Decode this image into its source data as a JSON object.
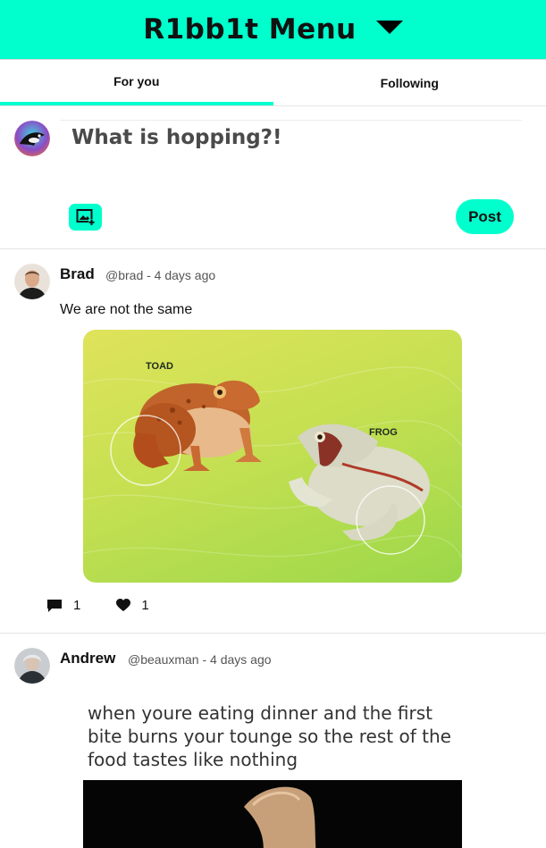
{
  "header": {
    "title": "R1bb1t Menu",
    "menu_icon": "caret-down-icon"
  },
  "tabs": [
    {
      "label": "For you",
      "active": true
    },
    {
      "label": "Following",
      "active": false
    }
  ],
  "composer": {
    "placeholder": "What is hopping?!",
    "media_icon": "add-image-icon",
    "post_label": "Post"
  },
  "posts": [
    {
      "name": "Brad",
      "meta": "@brad - 4 days ago",
      "text": "We are not the same",
      "image_labels": {
        "toad": "TOAD",
        "frog": "FROG"
      },
      "comments": "1",
      "likes": "1"
    },
    {
      "name": "Andrew",
      "meta": "@beauxman - 4 days ago",
      "caption": "when youre eating dinner and the first bite burns your tounge so the rest of the food tastes like nothing"
    }
  ],
  "colors": {
    "accent": "#00ffcc"
  }
}
